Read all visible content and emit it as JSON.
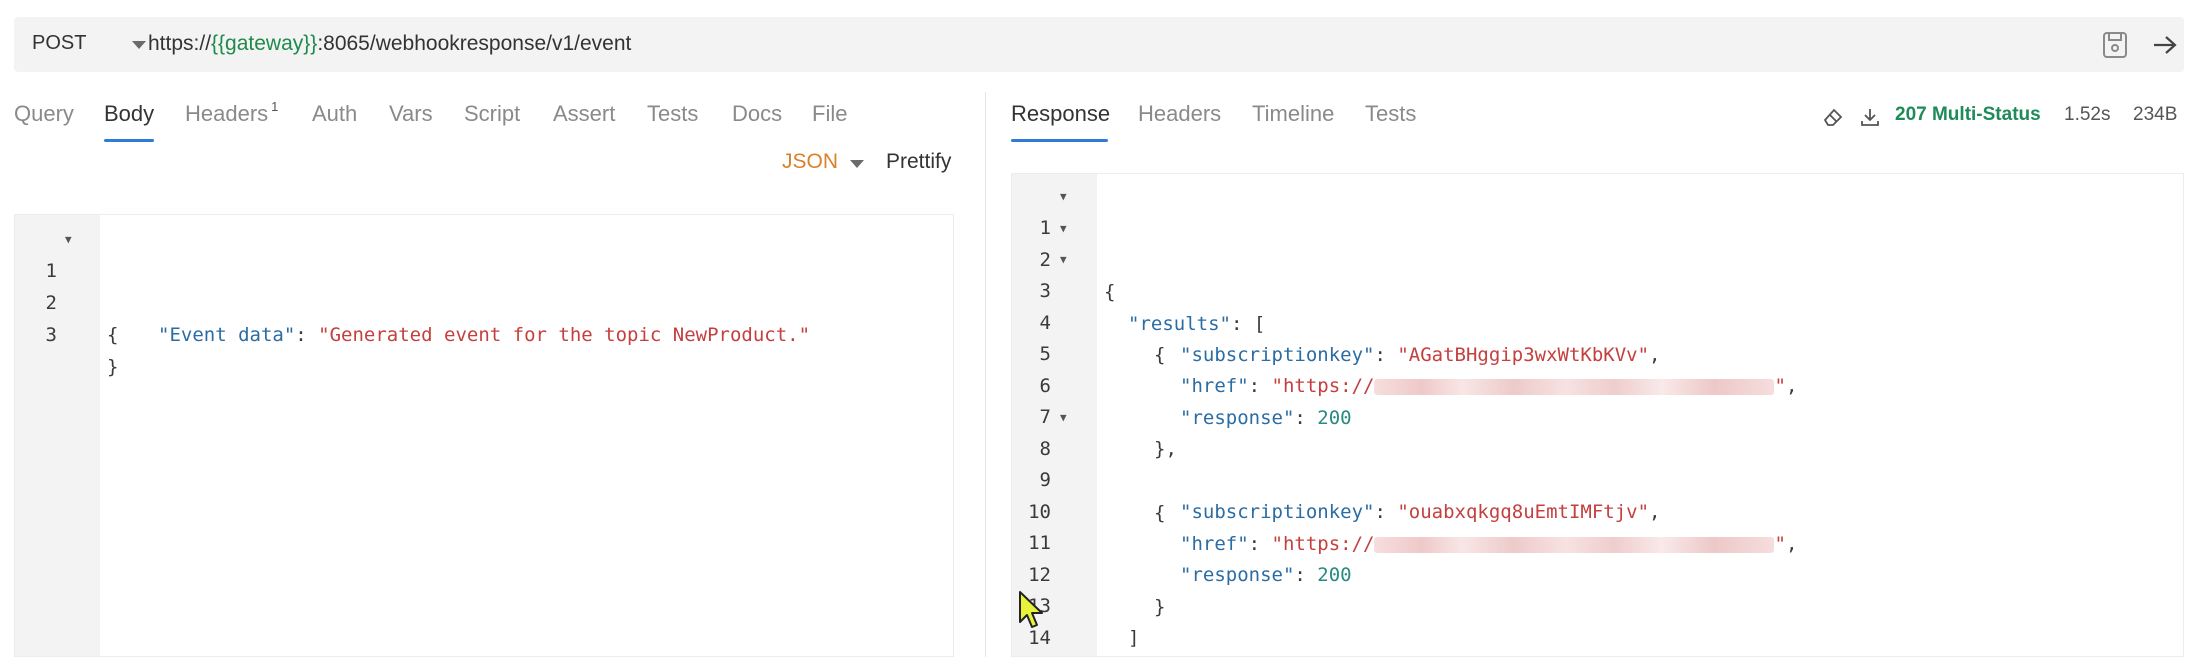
{
  "request": {
    "method": "POST",
    "url_prefix": "https://",
    "url_var": "{{gateway}}",
    "url_suffix": ":8065/webhookresponse/v1/event"
  },
  "request_tabs": {
    "query": "Query",
    "body": "Body",
    "headers": "Headers",
    "headers_count": "1",
    "auth": "Auth",
    "vars": "Vars",
    "script": "Script",
    "assert": "Assert",
    "tests": "Tests",
    "docs": "Docs",
    "file": "File"
  },
  "body_toolbar": {
    "mode": "JSON",
    "prettify": "Prettify"
  },
  "body_editor": {
    "line_numbers": [
      "1",
      "2",
      "3"
    ],
    "open_brace": "{",
    "key": "\"Event data\"",
    "colon": ": ",
    "value": "\"Generated event for the topic NewProduct.\"",
    "close_brace": "}"
  },
  "response_tabs": {
    "response": "Response",
    "headers": "Headers",
    "timeline": "Timeline",
    "tests": "Tests"
  },
  "response_meta": {
    "status": "207 Multi-Status",
    "time": "1.52s",
    "size": "234B"
  },
  "response_editor": {
    "line_numbers": [
      "1",
      "2",
      "3",
      "4",
      "5",
      "6",
      "7",
      "8",
      "9",
      "10",
      "11",
      "12",
      "13",
      "14"
    ],
    "open_brace": "{",
    "results_key": "\"results\"",
    "array_open": ": [",
    "obj_open": "{",
    "obj_close_comma": "},",
    "obj_close": "}",
    "array_close": "]",
    "close_brace": "}",
    "sub_key": "\"subscriptionkey\"",
    "href_key": "\"href\"",
    "response_key": "\"response\"",
    "colon": ": ",
    "comma": ",",
    "sub_value_1": "\"AGatBHggip3wxWtKbKVv\"",
    "sub_value_2": "\"ouabxqkgq8uEmtIMFtjv\"",
    "href_prefix": "\"https://",
    "href_suffix": "\"",
    "response_value": "200"
  }
}
